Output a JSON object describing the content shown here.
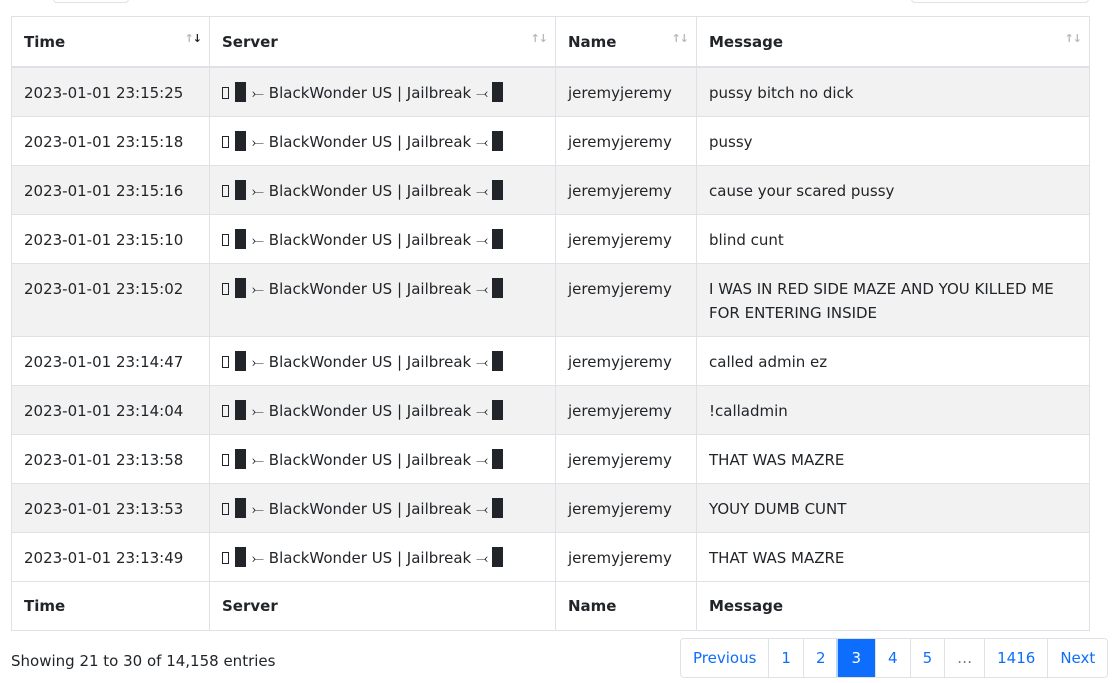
{
  "columns": [
    "Time",
    "Server",
    "Name",
    "Message"
  ],
  "rows": [
    {
      "time": "2023-01-01 23:15:25",
      "server": "BlackWonder US | Jailbreak",
      "name": "jeremyjeremy",
      "message": "pussy bitch no dick"
    },
    {
      "time": "2023-01-01 23:15:18",
      "server": "BlackWonder US | Jailbreak",
      "name": "jeremyjeremy",
      "message": "pussy"
    },
    {
      "time": "2023-01-01 23:15:16",
      "server": "BlackWonder US | Jailbreak",
      "name": "jeremyjeremy",
      "message": "cause your scared pussy"
    },
    {
      "time": "2023-01-01 23:15:10",
      "server": "BlackWonder US | Jailbreak",
      "name": "jeremyjeremy",
      "message": "blind cunt"
    },
    {
      "time": "2023-01-01 23:15:02",
      "server": "BlackWonder US | Jailbreak",
      "name": "jeremyjeremy",
      "message": "I WAS IN RED SIDE MAZE AND YOU KILLED ME FOR ENTERING INSIDE"
    },
    {
      "time": "2023-01-01 23:14:47",
      "server": "BlackWonder US | Jailbreak",
      "name": "jeremyjeremy",
      "message": "called admin ez"
    },
    {
      "time": "2023-01-01 23:14:04",
      "server": "BlackWonder US | Jailbreak",
      "name": "jeremyjeremy",
      "message": "!calladmin"
    },
    {
      "time": "2023-01-01 23:13:58",
      "server": "BlackWonder US | Jailbreak",
      "name": "jeremyjeremy",
      "message": "THAT WAS MAZRE"
    },
    {
      "time": "2023-01-01 23:13:53",
      "server": "BlackWonder US | Jailbreak",
      "name": "jeremyjeremy",
      "message": "YOUY DUMB CUNT"
    },
    {
      "time": "2023-01-01 23:13:49",
      "server": "BlackWonder US | Jailbreak",
      "name": "jeremyjeremy",
      "message": "THAT WAS MAZRE"
    }
  ],
  "server_prefix_glyph": "⤚",
  "server_suffix_glyph": "⤙",
  "info_text": "Showing 21 to 30 of 14,158 entries",
  "pagination": {
    "previous": "Previous",
    "pages": [
      "1",
      "2",
      "3",
      "4",
      "5",
      "…",
      "1416"
    ],
    "current": "3",
    "next": "Next"
  },
  "colors": {
    "accent": "#0d6efd",
    "stripe": "#f2f2f2",
    "border": "#dee2e6"
  }
}
